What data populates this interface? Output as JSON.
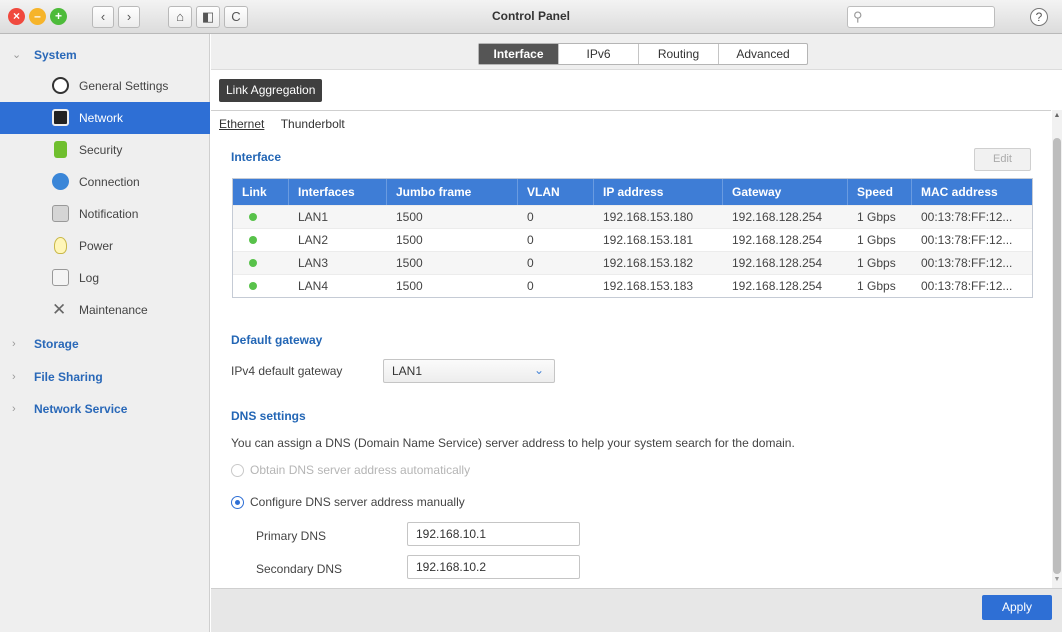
{
  "window": {
    "title": "Control Panel",
    "search_placeholder": "",
    "help_label": "?"
  },
  "toolbar": {
    "back": "‹",
    "forward": "›",
    "home": "⌂",
    "sidebar_toggle": "◧",
    "refresh": "C"
  },
  "sidebar": {
    "groups": [
      {
        "label": "System",
        "expanded": true
      },
      {
        "label": "Storage",
        "expanded": false
      },
      {
        "label": "File Sharing",
        "expanded": false
      },
      {
        "label": "Network Service",
        "expanded": false
      }
    ],
    "items": [
      {
        "label": "General Settings",
        "icon": "gear-icon"
      },
      {
        "label": "Network",
        "icon": "network-icon",
        "active": true
      },
      {
        "label": "Security",
        "icon": "lock-icon"
      },
      {
        "label": "Connection",
        "icon": "globe-icon"
      },
      {
        "label": "Notification",
        "icon": "notification-icon"
      },
      {
        "label": "Power",
        "icon": "bulb-icon"
      },
      {
        "label": "Log",
        "icon": "log-icon"
      },
      {
        "label": "Maintenance",
        "icon": "tools-icon"
      }
    ]
  },
  "tabs": [
    "Interface",
    "IPv6",
    "Routing",
    "Advanced"
  ],
  "active_tab": "Interface",
  "link_aggregation_label": "Link Aggregation",
  "subtabs": [
    "Ethernet",
    "Thunderbolt"
  ],
  "interface_section": {
    "title": "Interface",
    "edit_label": "Edit",
    "columns": [
      "Link",
      "Interfaces",
      "Jumbo frame",
      "VLAN",
      "IP address",
      "Gateway",
      "Speed",
      "MAC address"
    ],
    "rows": [
      {
        "link": "up",
        "interface": "LAN1",
        "jumbo": "1500",
        "vlan": "0",
        "ip": "192.168.153.180",
        "gateway": "192.168.128.254",
        "speed": "1 Gbps",
        "mac": "00:13:78:FF:12..."
      },
      {
        "link": "up",
        "interface": "LAN2",
        "jumbo": "1500",
        "vlan": "0",
        "ip": "192.168.153.181",
        "gateway": "192.168.128.254",
        "speed": "1 Gbps",
        "mac": "00:13:78:FF:12..."
      },
      {
        "link": "up",
        "interface": "LAN3",
        "jumbo": "1500",
        "vlan": "0",
        "ip": "192.168.153.182",
        "gateway": "192.168.128.254",
        "speed": "1 Gbps",
        "mac": "00:13:78:FF:12..."
      },
      {
        "link": "up",
        "interface": "LAN4",
        "jumbo": "1500",
        "vlan": "0",
        "ip": "192.168.153.183",
        "gateway": "192.168.128.254",
        "speed": "1 Gbps",
        "mac": "00:13:78:FF:12..."
      }
    ]
  },
  "default_gateway": {
    "title": "Default gateway",
    "label": "IPv4 default gateway",
    "value": "LAN1"
  },
  "dns": {
    "title": "DNS settings",
    "description": "You can assign a DNS (Domain Name Service) server address to help your system search for the domain.",
    "option_auto": "Obtain DNS server address automatically",
    "option_manual": "Configure DNS server address manually",
    "selected": "manual",
    "primary_label": "Primary DNS",
    "primary_value": "192.168.10.1",
    "secondary_label": "Secondary DNS",
    "secondary_value": "192.168.10.2"
  },
  "apply_label": "Apply",
  "colors": {
    "accent": "#2e6fd5",
    "table_header": "#3e7dd6",
    "section_title": "#2366b5",
    "link_up": "#58c24a"
  }
}
